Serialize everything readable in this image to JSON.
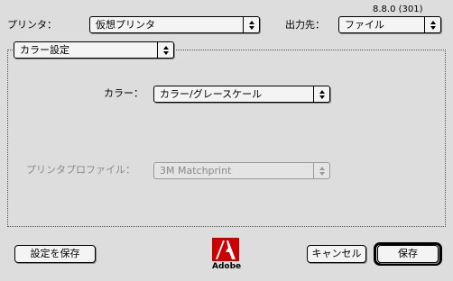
{
  "version": "8.8.0 (301)",
  "printer": {
    "label": "プリンタ：",
    "value": "仮想プリンタ"
  },
  "destination": {
    "label": "出力先：",
    "value": "ファイル"
  },
  "panel_selector": {
    "value": "カラー設定"
  },
  "color": {
    "label": "カラー：",
    "value": "カラー/グレースケール"
  },
  "printer_profile": {
    "label": "プリンタプロファイル：",
    "value": "3M Matchprint",
    "enabled": false
  },
  "buttons": {
    "save_settings": "設定を保存",
    "cancel": "キャンセル",
    "save": "保存"
  },
  "logo": {
    "text": "Adobe",
    "color": "#cc0000"
  }
}
